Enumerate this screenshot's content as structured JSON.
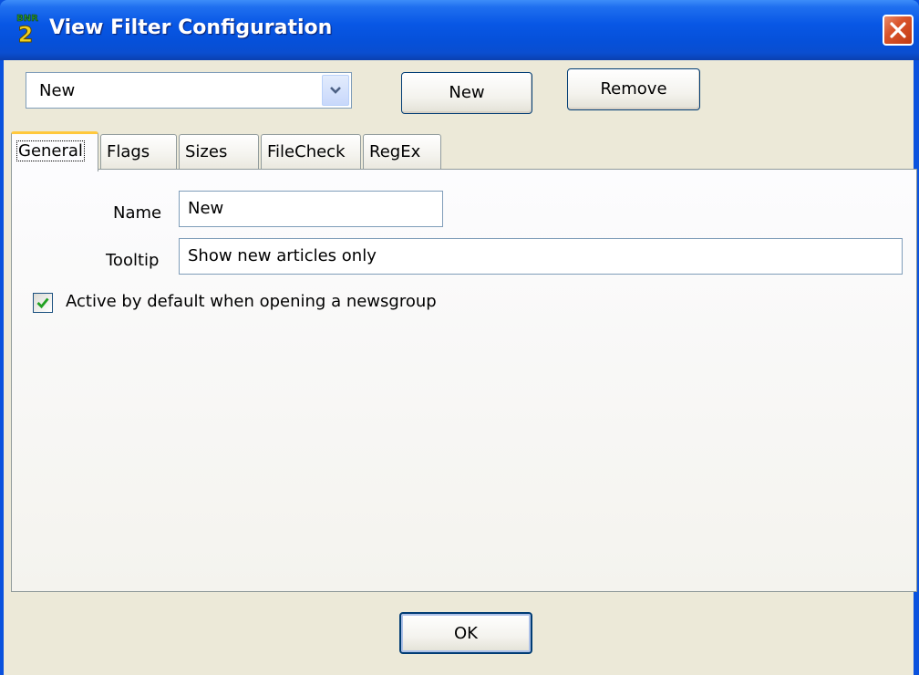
{
  "window": {
    "title": "View Filter Configuration",
    "app_icon": "bnr2-app-icon",
    "close_icon": "close-icon"
  },
  "toolbar": {
    "filter_select_value": "New",
    "new_label": "New",
    "remove_label": "Remove"
  },
  "tabs": [
    {
      "label": "General",
      "selected": true
    },
    {
      "label": "Flags",
      "selected": false
    },
    {
      "label": "Sizes",
      "selected": false
    },
    {
      "label": "FileCheck",
      "selected": false
    },
    {
      "label": "RegEx",
      "selected": false
    }
  ],
  "general": {
    "name_label": "Name",
    "name_value": "New",
    "tooltip_label": "Tooltip",
    "tooltip_value": "Show new articles only",
    "active_label": "Active by default when opening a newsgroup",
    "active_checked": true
  },
  "footer": {
    "ok_label": "OK"
  },
  "colors": {
    "titlebar": "#0650d9",
    "client_bg": "#ece9d8",
    "close_button": "#d9542b",
    "check_mark": "#21a121"
  }
}
